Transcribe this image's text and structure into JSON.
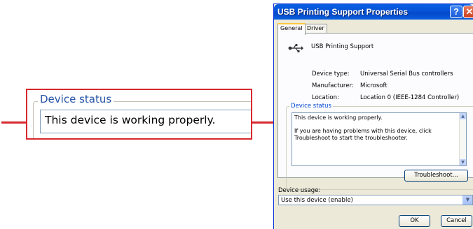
{
  "callout": {
    "legend": "Device status",
    "text": "This device is working properly."
  },
  "dialog": {
    "title": "USB Printing Support Properties",
    "help_glyph": "?",
    "close_glyph": "✕",
    "tabs": [
      {
        "label": "General",
        "active": true
      },
      {
        "label": "Driver",
        "active": false
      }
    ],
    "device_name": "USB Printing Support",
    "properties": [
      {
        "label": "Device type:",
        "value": "Universal Serial Bus controllers"
      },
      {
        "label": "Manufacturer:",
        "value": "Microsoft"
      },
      {
        "label": "Location:",
        "value": "Location 0 (IEEE-1284 Controller)"
      }
    ],
    "status": {
      "legend": "Device status",
      "line1": "This device is working properly.",
      "line2": "If you are having problems with this device, click Troubleshoot to start the troubleshooter."
    },
    "troubleshoot_label": "Troubleshoot...",
    "usage": {
      "label": "Device usage:",
      "selected": "Use this device (enable)"
    },
    "ok_label": "OK",
    "cancel_label": "Cancel"
  },
  "colors": {
    "callout_red": "#d8282d",
    "xp_title_blue": "#0653d8",
    "dialog_face": "#ece9d8"
  }
}
